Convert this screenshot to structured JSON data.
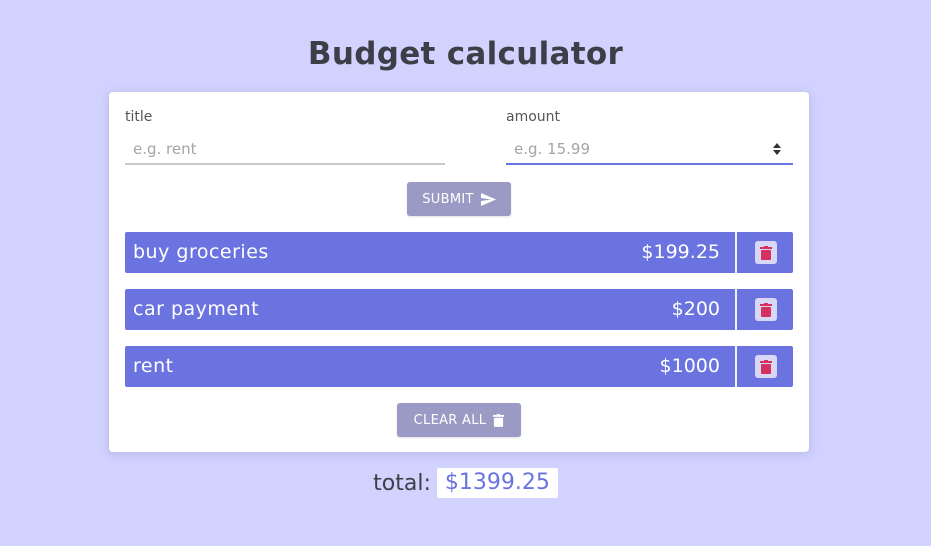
{
  "app": {
    "title": "Budget calculator"
  },
  "form": {
    "title_label": "title",
    "title_placeholder": "e.g. rent",
    "title_value": "",
    "amount_label": "amount",
    "amount_placeholder": "e.g. 15.99",
    "amount_value": "",
    "submit_label": "SUBMIT",
    "submit_icon": "send-icon"
  },
  "expenses": [
    {
      "title": "buy groceries",
      "amount": "$199.25",
      "delete_icon": "trash-icon"
    },
    {
      "title": "car payment",
      "amount": "$200",
      "delete_icon": "trash-icon"
    },
    {
      "title": "rent",
      "amount": "$1000",
      "delete_icon": "trash-icon"
    }
  ],
  "actions": {
    "clear_all_label": "CLEAR ALL",
    "clear_all_icon": "trash-icon"
  },
  "summary": {
    "total_label": "total:",
    "total_value": "$1399.25"
  },
  "colors": {
    "background": "#d2d2fe",
    "accent": "#6b73e0",
    "button": "#9a9ac4",
    "delete_icon": "#d6305f"
  }
}
